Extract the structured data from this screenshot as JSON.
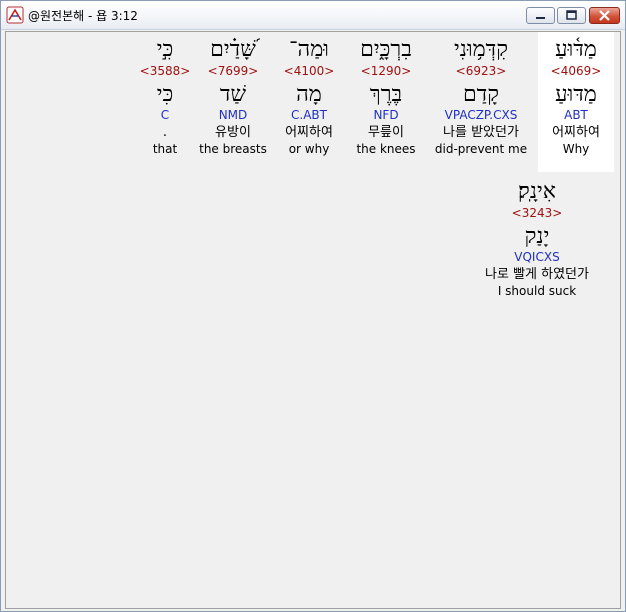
{
  "window": {
    "title": "@원전본해 - 욥 3:12"
  },
  "words": [
    {
      "hebrew": "מַדּ֫וּעַ",
      "strong": "<4069>",
      "lemma": "מַדּוּעַ",
      "morph": "ABT",
      "korean": "어찌하여",
      "english": "Why",
      "selected": true
    },
    {
      "hebrew": "קִדְּמ֥וּנִי",
      "strong": "<6923>",
      "lemma": "קָדַם",
      "morph": "VPACZP.CXS",
      "korean": "나를 받았던가",
      "english": "did-prevent me"
    },
    {
      "hebrew": "בִרְכָּ֑יִם",
      "strong": "<1290>",
      "lemma": "בֶּרֶךְ",
      "morph": "NFD",
      "korean": "무릎이",
      "english": "the knees"
    },
    {
      "hebrew": "וּמַה־",
      "strong": "<4100>",
      "lemma": "מָה",
      "morph": "C.ABT",
      "korean": "어찌하여",
      "english": "or why"
    },
    {
      "hebrew": "שָּׁ֝דַ֗יִם",
      "strong": "<7699>",
      "lemma": "שַׁד",
      "morph": "NMD",
      "korean": "유방이",
      "english": "the breasts"
    },
    {
      "hebrew": "כִּ֣י",
      "strong": "<3588>",
      "lemma": "כִּי",
      "morph": "C",
      "korean": ".",
      "english": "that"
    },
    {
      "hebrew": "אִינָֽק׃",
      "strong": "<3243>",
      "lemma": "יָנַק",
      "morph": "VQICXS",
      "korean": "나로 빨게 하였던가",
      "english": "I should suck"
    }
  ]
}
